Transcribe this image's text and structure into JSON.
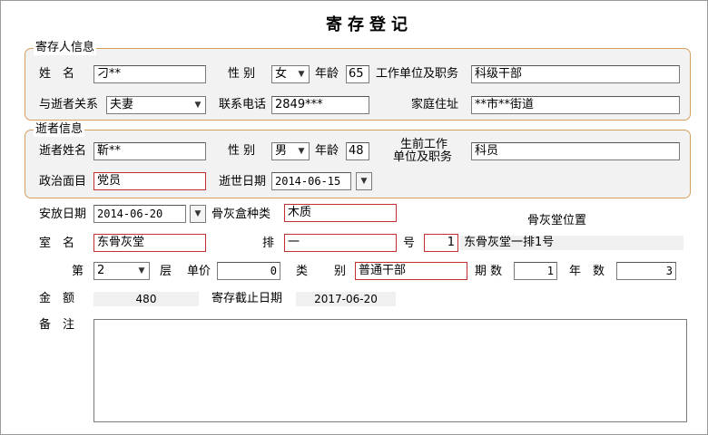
{
  "title": "寄存登记",
  "depositor": {
    "legend": "寄存人信息",
    "name_label": "姓　名",
    "name_value": "刁**",
    "gender_label": "性 别",
    "gender_value": "女",
    "age_label": "年龄",
    "age_value": "65",
    "work_label": "工作单位及职务",
    "work_value": "科级干部",
    "relation_label": "与逝者关系",
    "relation_value": "夫妻",
    "phone_label": "联系电话",
    "phone_value": "2849***",
    "address_label": "家庭住址",
    "address_value": "**市**街道"
  },
  "deceased": {
    "legend": "逝者信息",
    "name_label": "逝者姓名",
    "name_value": "靳**",
    "gender_label": "性 别",
    "gender_value": "男",
    "age_label": "年龄",
    "age_value": "48",
    "work_label_line1": "生前工作",
    "work_label_line2": "单位及职务",
    "work_value": "科员",
    "politics_label": "政治面目",
    "politics_value": "党员",
    "death_date_label": "逝世日期",
    "death_date_value": "2014-06-15"
  },
  "placement": {
    "date_label": "安放日期",
    "date_value": "2014-06-20",
    "box_label": "骨灰盒种类",
    "box_value": "木质",
    "position_heading": "骨灰堂位置",
    "room_label": "室　名",
    "room_value": "东骨灰堂",
    "row_label": "排",
    "row_value": "一",
    "number_label": "号",
    "number_value": "1",
    "position_value": "东骨灰堂一排1号",
    "floor_prefix": "第",
    "floor_value": "2",
    "floor_suffix": "层",
    "price_label": "单价",
    "price_value": "0",
    "category_label": "类　别",
    "category_value": "普通干部",
    "period_label": "期 数",
    "period_value": "1",
    "years_label": "年　数",
    "years_value": "3",
    "amount_label": "金　额",
    "amount_value": "480",
    "deadline_label": "寄存截止日期",
    "deadline_value": "2017-06-20",
    "remark_label": "备　注"
  },
  "colors": {
    "group_border": "#d8a060",
    "required_border": "#c03030",
    "group_bg": "#f2f2f2"
  }
}
